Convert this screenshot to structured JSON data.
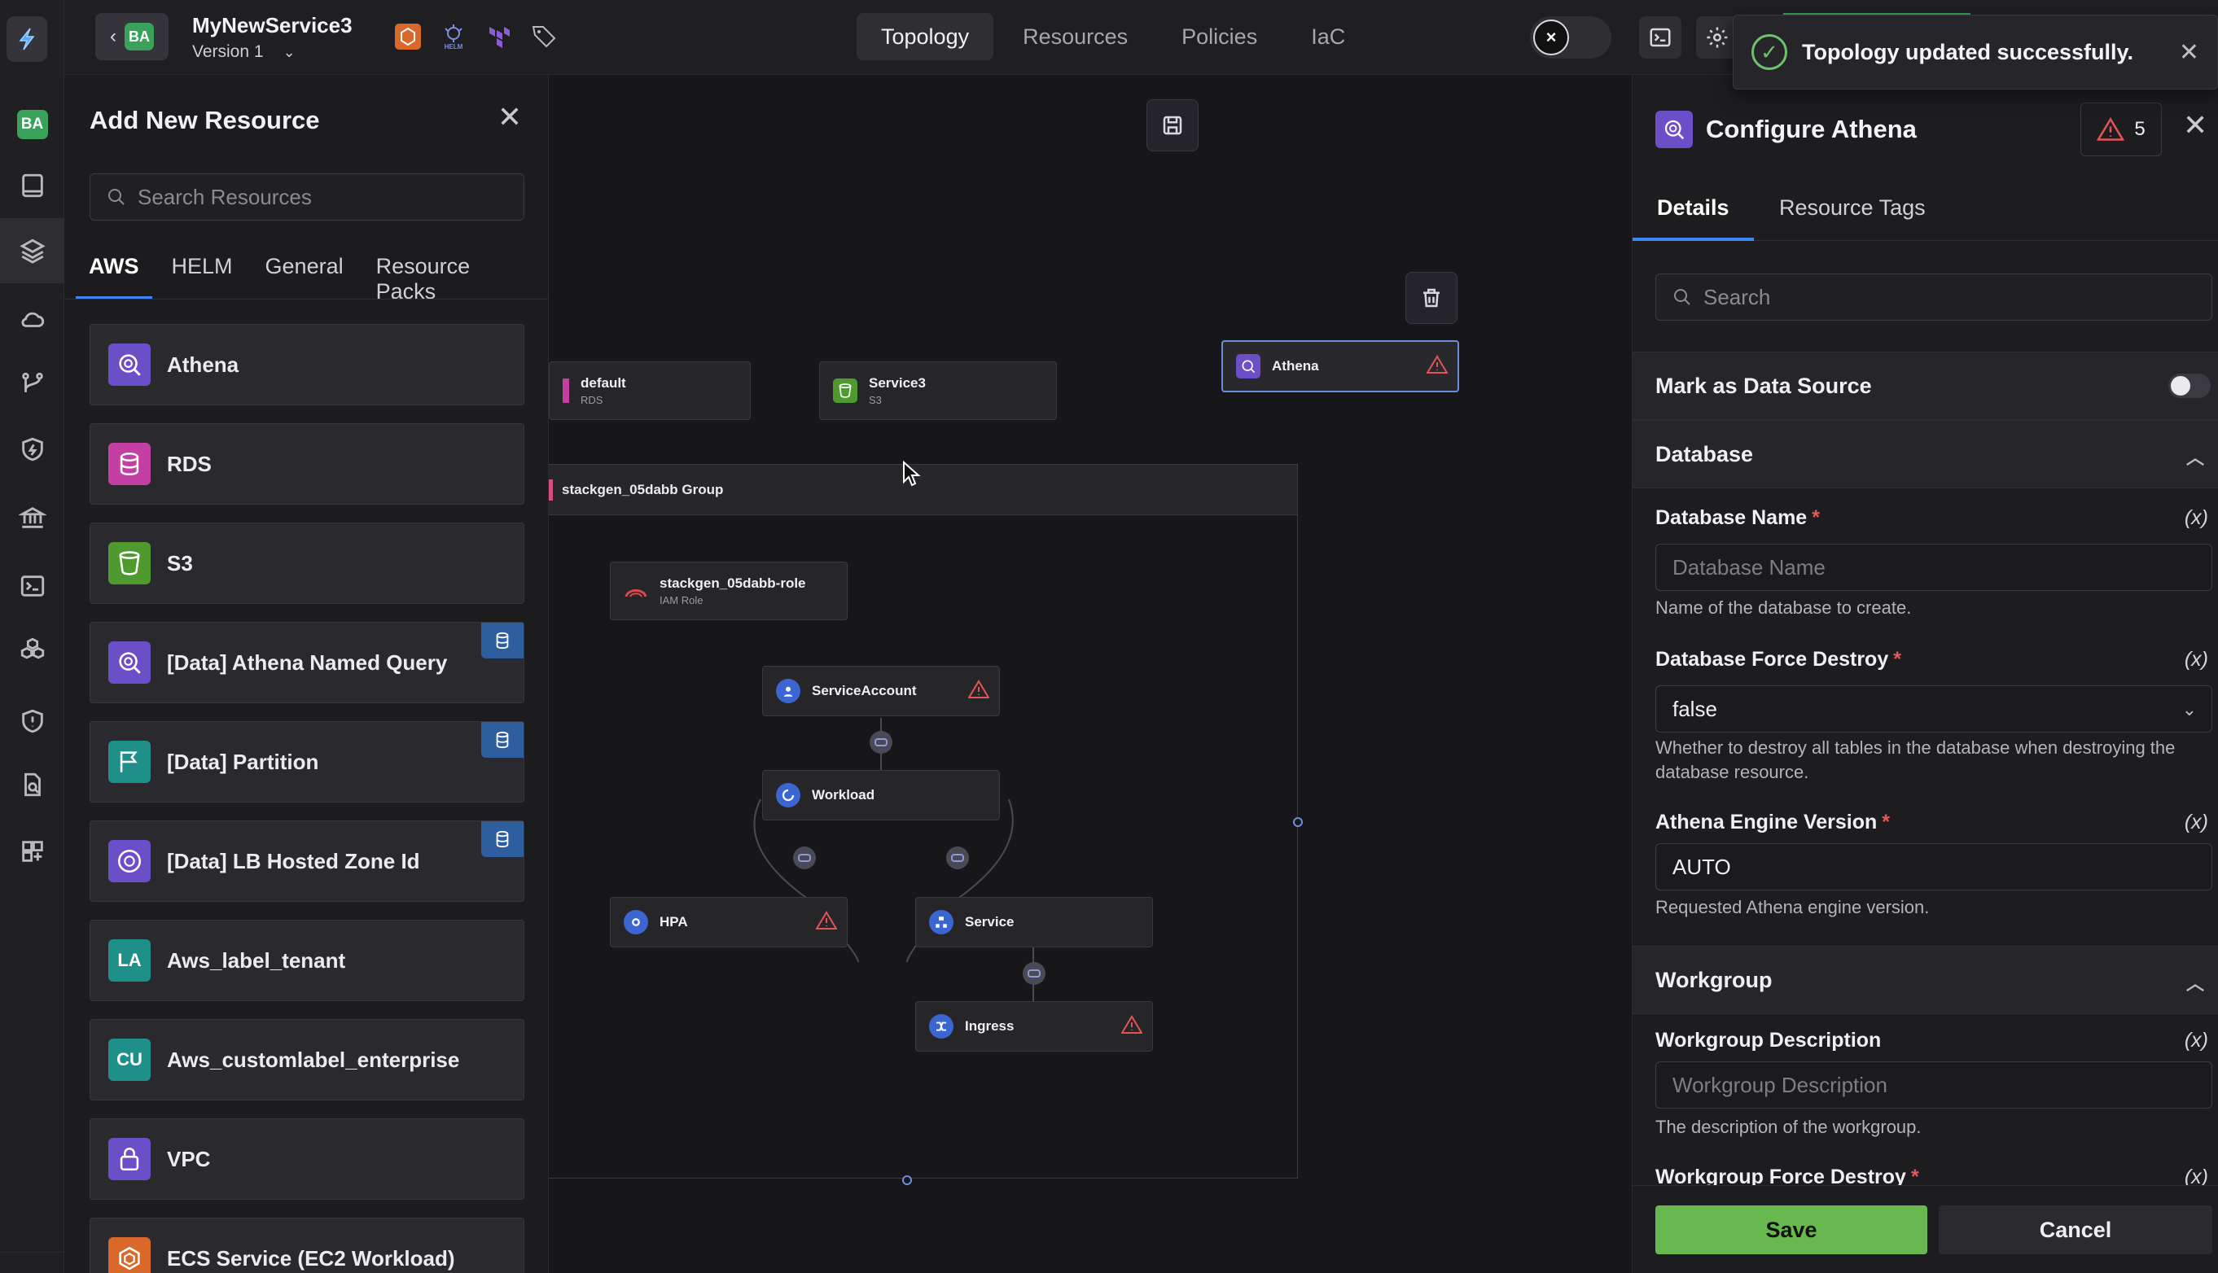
{
  "workspace": {
    "initials": "BA"
  },
  "header": {
    "service_name": "MyNewService3",
    "version": "Version 1",
    "nav_tabs": [
      {
        "label": "Topology",
        "active": true
      },
      {
        "label": "Resources",
        "active": false
      },
      {
        "label": "Policies",
        "active": false
      },
      {
        "label": "IaC",
        "active": false
      }
    ],
    "helm_label": "HELM"
  },
  "toast": {
    "message": "Topology updated successfully."
  },
  "left_panel": {
    "title": "Add New Resource",
    "search_placeholder": "Search Resources",
    "tabs": [
      {
        "label": "AWS",
        "active": true
      },
      {
        "label": "HELM",
        "active": false
      },
      {
        "label": "General",
        "active": false
      },
      {
        "label": "Resource Packs",
        "active": false
      }
    ],
    "resources": [
      {
        "name": "Athena",
        "icon": "athena-icon",
        "color": "#6a4fc9",
        "data": false
      },
      {
        "name": "RDS",
        "icon": "rds-icon",
        "color": "#c43fa3",
        "data": false
      },
      {
        "name": "S3",
        "icon": "s3-icon",
        "color": "#4e9a2f",
        "data": false
      },
      {
        "name": "[Data] Athena Named Query",
        "icon": "athena-icon",
        "color": "#6a4fc9",
        "data": true
      },
      {
        "name": "[Data] Partition",
        "icon": "flag-icon",
        "color": "#1f8f8a",
        "data": true
      },
      {
        "name": "[Data] LB Hosted Zone Id",
        "icon": "lb-icon",
        "color": "#6a4fc9",
        "data": true
      },
      {
        "name": "Aws_label_tenant",
        "icon_text": "LA",
        "color": "#1f8f8a",
        "data": false
      },
      {
        "name": "Aws_customlabel_enterprise",
        "icon_text": "CU",
        "color": "#1f8f8a",
        "data": false
      },
      {
        "name": "VPC",
        "icon": "lock-icon",
        "color": "#6a4fc9",
        "data": false
      },
      {
        "name": "ECS Service (EC2 Workload)",
        "icon": "ecs-icon",
        "color": "#d9692b",
        "data": false
      }
    ]
  },
  "canvas": {
    "nodes": {
      "default": {
        "title": "default",
        "sub": "RDS"
      },
      "service3": {
        "title": "Service3",
        "sub": "S3"
      },
      "athena": {
        "title": "Athena"
      },
      "group": {
        "title": "stackgen_05dabb Group"
      },
      "role": {
        "title": "stackgen_05dabb-role",
        "sub": "IAM Role"
      },
      "service_account": {
        "title": "ServiceAccount"
      },
      "workload": {
        "title": "Workload"
      },
      "hpa": {
        "title": "HPA"
      },
      "service": {
        "title": "Service"
      },
      "ingress": {
        "title": "Ingress"
      }
    }
  },
  "right_panel": {
    "title": "Configure Athena",
    "warning_count": "5",
    "tabs": [
      {
        "label": "Details",
        "active": true
      },
      {
        "label": "Resource Tags",
        "active": false
      }
    ],
    "search_placeholder": "Search",
    "mark_data_source": "Mark as Data Source",
    "sections": {
      "database": "Database",
      "workgroup": "Workgroup"
    },
    "fields": {
      "db_name_label": "Database Name",
      "db_name_placeholder": "Database Name",
      "db_name_help": "Name of the database to create.",
      "db_force_label": "Database Force Destroy",
      "db_force_value": "false",
      "db_force_help": "Whether to destroy all tables in the database when destroying the database resource.",
      "engine_label": "Athena Engine Version",
      "engine_value": "AUTO",
      "engine_help": "Requested Athena engine version.",
      "wg_desc_label": "Workgroup Description",
      "wg_desc_placeholder": "Workgroup Description",
      "wg_desc_help": "The description of the workgroup.",
      "wg_force_label": "Workgroup Force Destroy",
      "var_token": "(x)",
      "required_mark": "*"
    },
    "save_label": "Save",
    "cancel_label": "Cancel"
  }
}
